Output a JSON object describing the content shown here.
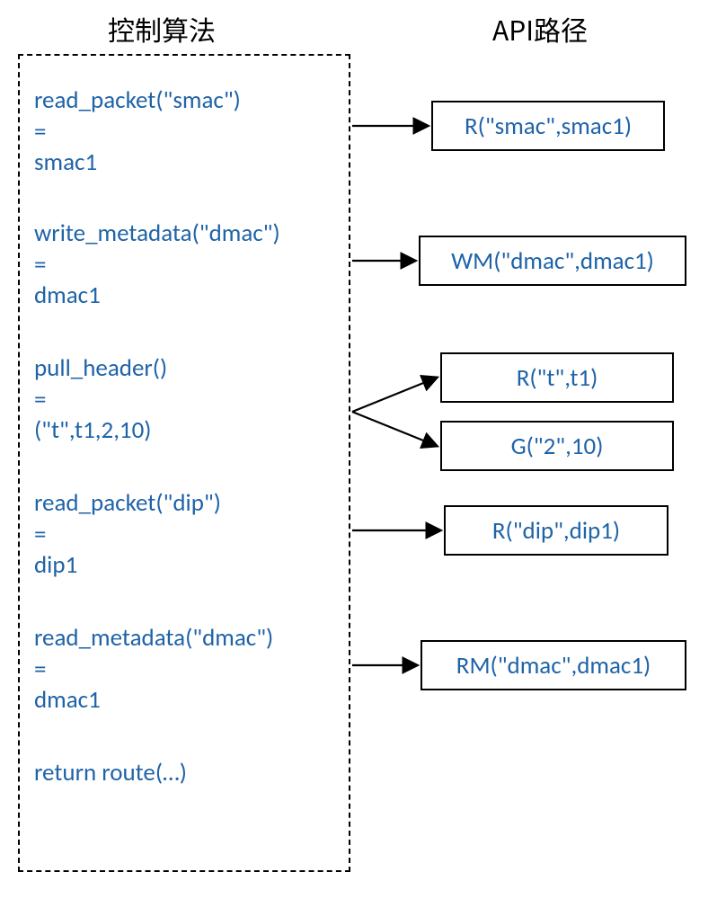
{
  "titles": {
    "left": "控制算法",
    "right": "API路径"
  },
  "code": {
    "b1": {
      "l1": "read_packet(\"smac\")",
      "l2": "=",
      "l3": "smac1"
    },
    "b2": {
      "l1": "write_metadata(\"dmac\")",
      "l2": "=",
      "l3": "dmac1"
    },
    "b3": {
      "l1": "pull_header()",
      "l2": "=",
      "l3": "(\"t\",t1,2,10)"
    },
    "b4": {
      "l1": "read_packet(\"dip\")",
      "l2": "=",
      "l3": "dip1"
    },
    "b5": {
      "l1": "read_metadata(\"dmac\")",
      "l2": "=",
      "l3": "dmac1"
    },
    "b6": "return route(…)"
  },
  "api": {
    "a1": "R(\"smac\",smac1)",
    "a2": "WM(\"dmac\",dmac1)",
    "a3": "R(\"t\",t1)",
    "a4": "G(\"2\",10)",
    "a5": "R(\"dip\",dip1)",
    "a6": "RM(\"dmac\",dmac1)"
  }
}
